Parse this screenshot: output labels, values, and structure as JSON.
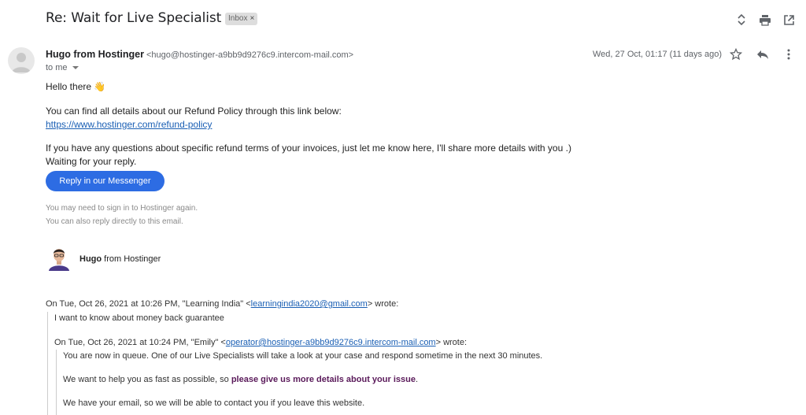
{
  "email": {
    "subject": "Re: Wait for Live Specialist",
    "label": "Inbox",
    "label_close": "×",
    "sender_name": "Hugo from Hostinger",
    "sender_email": "<hugo@hostinger-a9bb9d9276c9.intercom-mail.com>",
    "to": "to me",
    "date": "Wed, 27 Oct, 01:17 (11 days ago)"
  },
  "icons": {
    "expand": "unfold-icon",
    "print": "print-icon",
    "new_window": "open-in-new-window-icon",
    "star": "star-icon",
    "reply": "reply-icon",
    "more": "more-vert-icon"
  },
  "body": {
    "greeting": "Hello there",
    "greeting_emoji": "👋",
    "line1": "You can find all details about our Refund Policy through this link below:",
    "link": "https://www.hostinger.com/refund-policy",
    "line2": "If you have any questions about specific refund terms of your invoices, just let me know here, I'll share more details with you .)",
    "line3": "Waiting for your reply.",
    "button": "Reply in our Messenger",
    "note1": "You may need to sign in to Hostinger again.",
    "note2": "You can also reply directly to this email."
  },
  "signature": {
    "name": "Hugo",
    "rest": "from Hostinger"
  },
  "quote1": {
    "header_before": "On Tue, Oct 26, 2021 at 10:26 PM, \"Learning India\" <",
    "header_email": "learningindia2020@gmail.com",
    "header_after": "> wrote:",
    "text": "I want to know about money back guarantee"
  },
  "quote2": {
    "header_before": "On Tue, Oct 26, 2021 at 10:24 PM, \"Emily\" <",
    "header_email": "operator@hostinger-a9bb9d9276c9.intercom-mail.com",
    "header_after": "> wrote:",
    "line1": "You are now in queue. One of our Live Specialists will take a look at your case and respond sometime in the next 30 minutes.",
    "line2_before": "We want to help you as fast as possible, so ",
    "line2_bold": "please give us more details about your issue",
    "line2_after": ".",
    "line3": "We have your email, so we will be able to contact you if you leave this website."
  },
  "colors": {
    "button": "#2d6ce3",
    "link": "#1a5fb4",
    "emphasis": "#5a1a5a"
  }
}
